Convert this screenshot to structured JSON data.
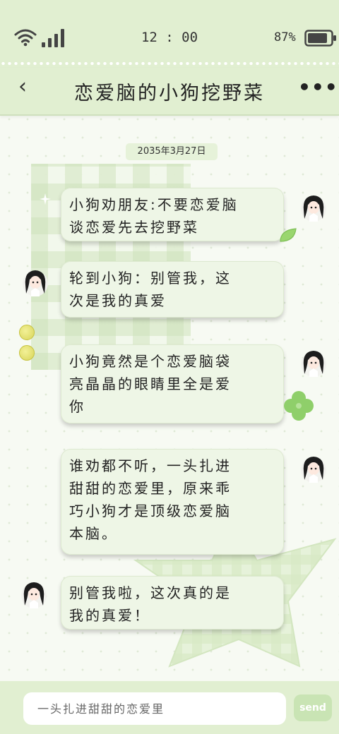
{
  "status_bar": {
    "time": "12 : 00",
    "battery_percent": "87%",
    "battery_level": 0.87,
    "wifi_icon": "wifi-icon",
    "signal_icon": "cellular-signal-icon"
  },
  "header": {
    "back_icon": "chevron-left-icon",
    "back_glyph": "‹",
    "title": "恋爱脑的小狗挖野菜",
    "more_icon": "more-dots-icon",
    "more_glyph": "•••"
  },
  "chat": {
    "date": "2035年3月27日",
    "messages": [
      {
        "side": "right",
        "text": "小狗劝朋友:不要恋爱脑\n谈恋爱先去挖野菜"
      },
      {
        "side": "left",
        "text": "轮到小狗：别管我，这\n次是我的真爱"
      },
      {
        "side": "right",
        "text": "小狗竟然是个恋爱脑袋\n亮晶晶的眼睛里全是爱\n你"
      },
      {
        "side": "right",
        "text": "谁劝都不听，一头扎进\n甜甜的恋爱里，原来乖\n巧小狗才是顶级恋爱脑\n本脑。"
      },
      {
        "side": "left",
        "text": "别管我啦，这次真的是\n我的真爱！"
      }
    ]
  },
  "composer": {
    "placeholder": "一头扎进甜甜的恋爱里",
    "send_label": "send"
  },
  "colors": {
    "header_bg": "#e1efd1",
    "bubble_bg": "#eef6e6",
    "accent_green": "#8fcf6a",
    "send_bg": "#c9e4b4"
  }
}
